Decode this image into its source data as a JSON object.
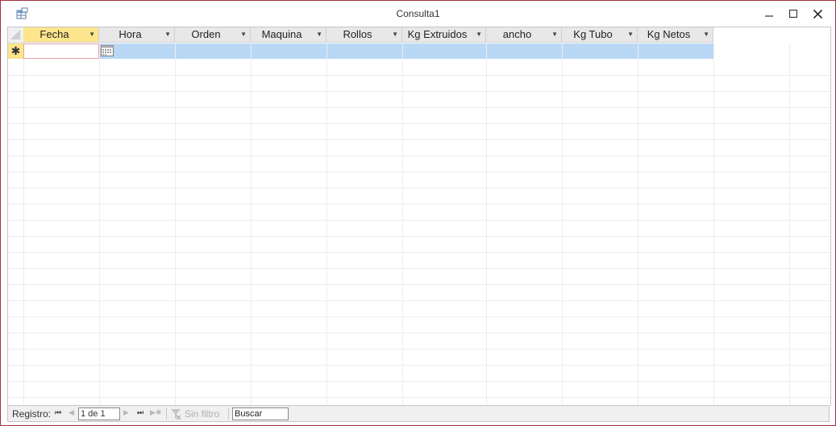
{
  "window": {
    "title": "Consulta1"
  },
  "columns": [
    {
      "label": "Fecha",
      "active": true
    },
    {
      "label": "Hora"
    },
    {
      "label": "Orden"
    },
    {
      "label": "Maquina"
    },
    {
      "label": "Rollos"
    },
    {
      "label": "Kg Extruidos"
    },
    {
      "label": "ancho"
    },
    {
      "label": "Kg Tubo"
    },
    {
      "label": "Kg Netos"
    }
  ],
  "new_row_marker": "✱",
  "navigation": {
    "label": "Registro:",
    "record_value": "1 de 1",
    "filter_label": "Sin filtro",
    "search_value": "Buscar"
  },
  "colors": {
    "active_header": "#fde58b",
    "new_row": "#b9d8f5",
    "border": "#a0323c"
  }
}
